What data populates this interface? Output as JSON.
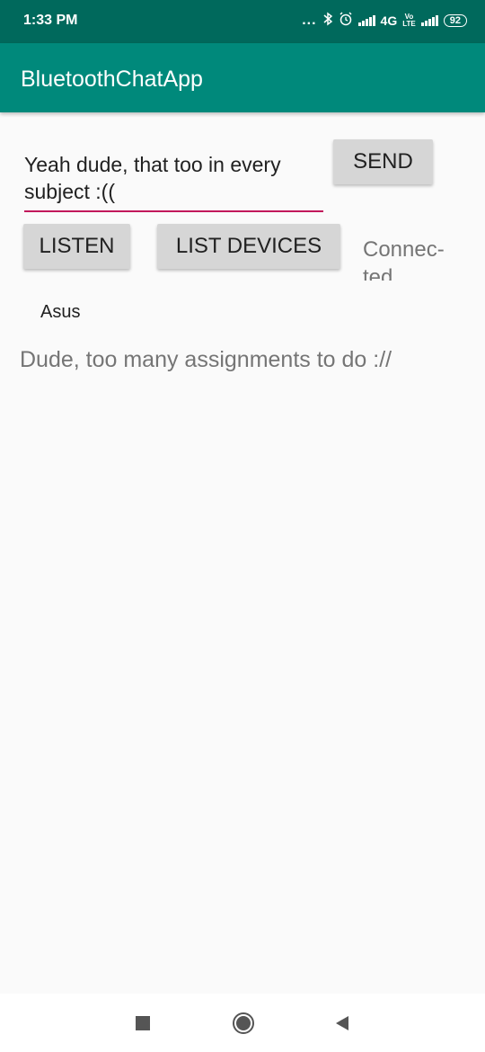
{
  "status_bar": {
    "time": "1:33 PM",
    "dots": "...",
    "network": "4G",
    "volte_top": "Vo",
    "volte_bottom": "LTE",
    "battery": "92",
    "icons": [
      "bluetooth-icon",
      "alarm-icon",
      "signal-icon",
      "signal-icon",
      "battery-icon"
    ]
  },
  "app_bar": {
    "title": "BluetoothChatApp",
    "color": "#00897b"
  },
  "message_input": {
    "value": "Yeah dude, that too in every subject :((",
    "underline_color": "#c2185b"
  },
  "buttons": {
    "send": "SEND",
    "listen": "LISTEN",
    "list_devices": "LIST DEVICES"
  },
  "status": {
    "text": "Connec-ted"
  },
  "devices": [
    "Asus"
  ],
  "received_message": "Dude, too many assignments to do ://",
  "nav": {
    "icons": [
      "recent-apps-icon",
      "home-icon",
      "back-icon"
    ]
  }
}
